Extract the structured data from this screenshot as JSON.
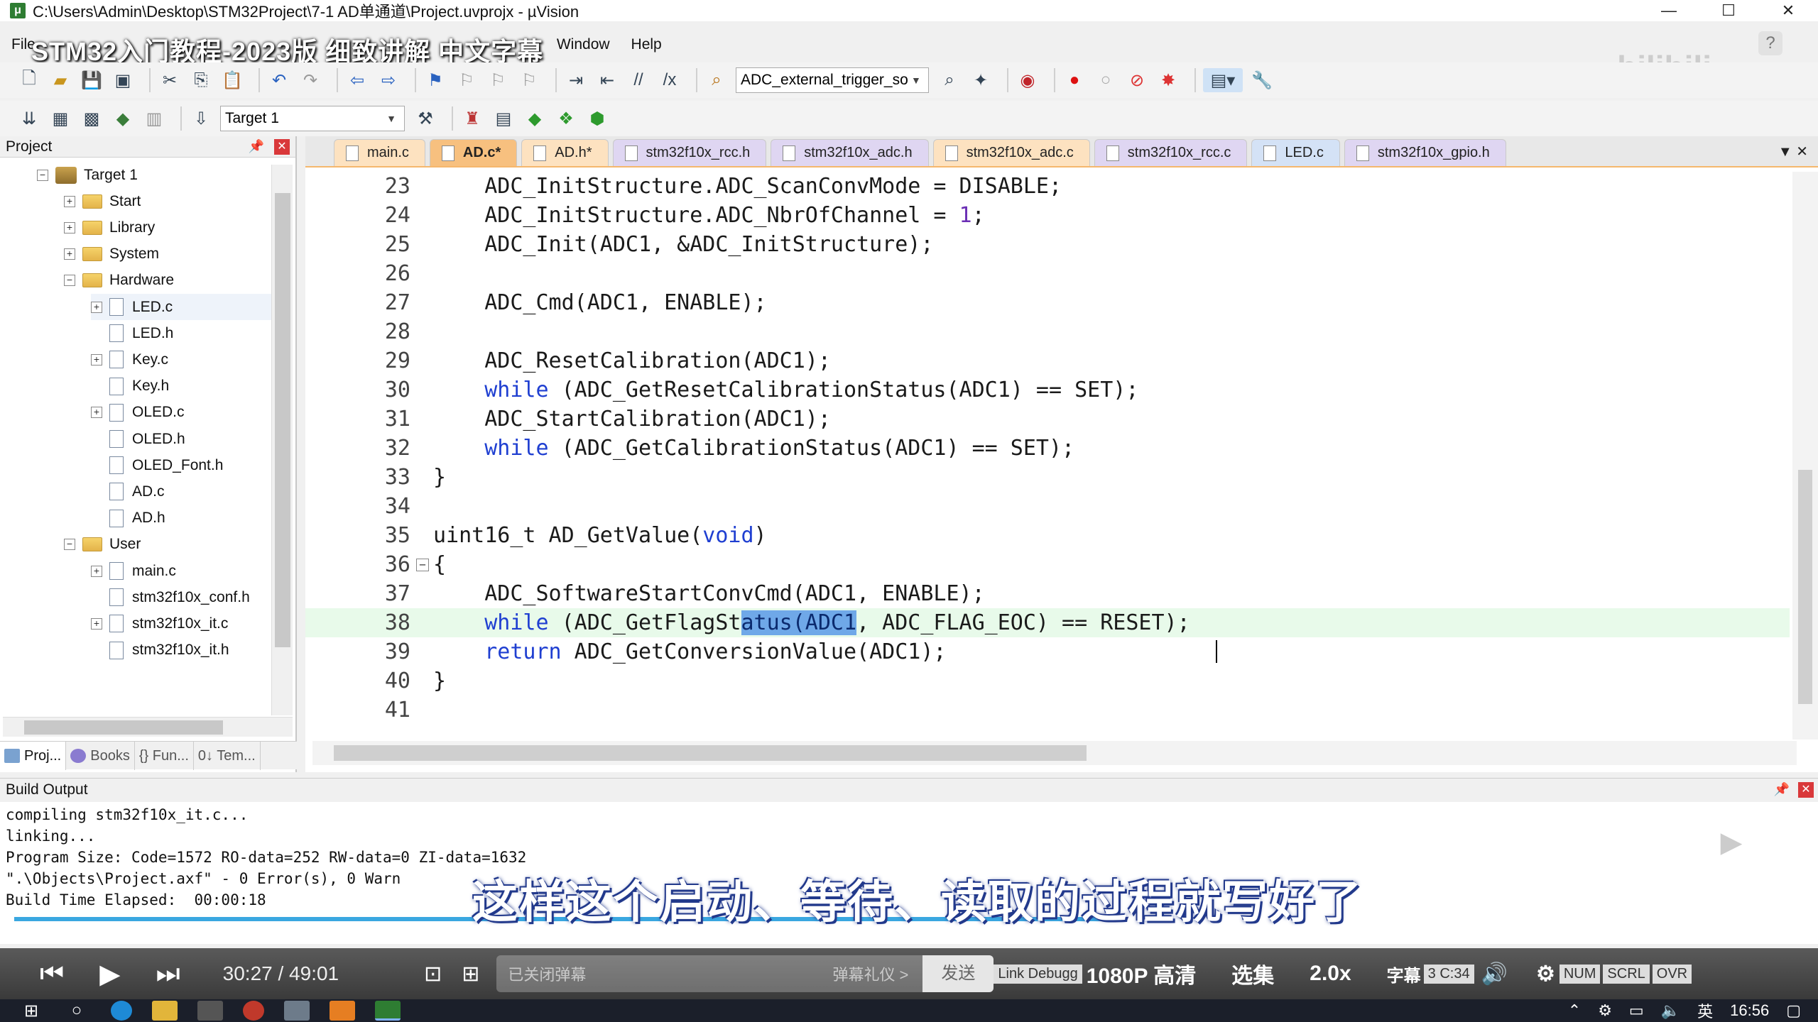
{
  "window": {
    "title": "C:\\Users\\Admin\\Desktop\\STM32Project\\7-1 AD单通道\\Project.uvprojx - µVision",
    "controls": [
      "—",
      "☐",
      "✕"
    ]
  },
  "overlay_title": "STM32入门教程-2023版 细致讲解 中文字幕",
  "watermark": "bilibili",
  "menu": {
    "items": [
      "File",
      "Window",
      "Help"
    ]
  },
  "toolbar": {
    "define_combo": "ADC_external_trigger_so",
    "target_combo": "Target 1"
  },
  "project_panel": {
    "title": "Project",
    "tree": [
      {
        "label": "Target 1",
        "level": 0,
        "type": "target",
        "exp": "−"
      },
      {
        "label": "Start",
        "level": 1,
        "type": "folder",
        "exp": "+"
      },
      {
        "label": "Library",
        "level": 1,
        "type": "folder",
        "exp": "+"
      },
      {
        "label": "System",
        "level": 1,
        "type": "folder",
        "exp": "+"
      },
      {
        "label": "Hardware",
        "level": 1,
        "type": "folder",
        "exp": "−"
      },
      {
        "label": "LED.c",
        "level": 2,
        "type": "file",
        "exp": "+"
      },
      {
        "label": "LED.h",
        "level": 2,
        "type": "file",
        "exp": ""
      },
      {
        "label": "Key.c",
        "level": 2,
        "type": "file",
        "exp": "+"
      },
      {
        "label": "Key.h",
        "level": 2,
        "type": "file",
        "exp": ""
      },
      {
        "label": "OLED.c",
        "level": 2,
        "type": "file",
        "exp": "+"
      },
      {
        "label": "OLED.h",
        "level": 2,
        "type": "file",
        "exp": ""
      },
      {
        "label": "OLED_Font.h",
        "level": 2,
        "type": "file",
        "exp": ""
      },
      {
        "label": "AD.c",
        "level": 2,
        "type": "file",
        "exp": ""
      },
      {
        "label": "AD.h",
        "level": 2,
        "type": "file",
        "exp": ""
      },
      {
        "label": "User",
        "level": 1,
        "type": "folder",
        "exp": "−"
      },
      {
        "label": "main.c",
        "level": 2,
        "type": "file",
        "exp": "+"
      },
      {
        "label": "stm32f10x_conf.h",
        "level": 2,
        "type": "file",
        "exp": ""
      },
      {
        "label": "stm32f10x_it.c",
        "level": 2,
        "type": "file",
        "exp": "+"
      },
      {
        "label": "stm32f10x_it.h",
        "level": 2,
        "type": "file",
        "exp": ""
      }
    ],
    "bottom_tabs": [
      "Proj...",
      "Books",
      "{} Fun...",
      "0↓ Tem..."
    ]
  },
  "editor": {
    "tabs": [
      {
        "label": "main.c",
        "style": "orange"
      },
      {
        "label": "AD.c*",
        "style": "active"
      },
      {
        "label": "AD.h*",
        "style": "orange"
      },
      {
        "label": "stm32f10x_rcc.h",
        "style": "violet"
      },
      {
        "label": "stm32f10x_adc.h",
        "style": "violet"
      },
      {
        "label": "stm32f10x_adc.c",
        "style": "orange"
      },
      {
        "label": "stm32f10x_rcc.c",
        "style": "violet"
      },
      {
        "label": "LED.c",
        "style": "blue"
      },
      {
        "label": "stm32f10x_gpio.h",
        "style": "violet"
      }
    ],
    "lines": [
      {
        "n": "23",
        "text": "    ADC_InitStructure.ADC_ScanConvMode = DISABLE;"
      },
      {
        "n": "24",
        "text": "    ADC_InitStructure.ADC_NbrOfChannel = 1;"
      },
      {
        "n": "25",
        "text": "    ADC_Init(ADC1, &ADC_InitStructure);"
      },
      {
        "n": "26",
        "text": ""
      },
      {
        "n": "27",
        "text": "    ADC_Cmd(ADC1, ENABLE);"
      },
      {
        "n": "28",
        "text": ""
      },
      {
        "n": "29",
        "text": "    ADC_ResetCalibration(ADC1);"
      },
      {
        "n": "30",
        "text": "    while (ADC_GetResetCalibrationStatus(ADC1) == SET);"
      },
      {
        "n": "31",
        "text": "    ADC_StartCalibration(ADC1);"
      },
      {
        "n": "32",
        "text": "    while (ADC_GetCalibrationStatus(ADC1) == SET);"
      },
      {
        "n": "33",
        "text": "}"
      },
      {
        "n": "34",
        "text": ""
      },
      {
        "n": "35",
        "text": "uint16_t AD_GetValue(void)"
      },
      {
        "n": "36",
        "text": "{"
      },
      {
        "n": "37",
        "text": "    ADC_SoftwareStartConvCmd(ADC1, ENABLE);"
      },
      {
        "n": "38",
        "text": "    while (ADC_GetFlagStatus(ADC1, ADC_FLAG_EOC) == RESET);"
      },
      {
        "n": "39",
        "text": "    return ADC_GetConversionValue(ADC1);"
      },
      {
        "n": "40",
        "text": "}"
      },
      {
        "n": "41",
        "text": ""
      }
    ]
  },
  "build_output": {
    "title": "Build Output",
    "lines": [
      "compiling stm32f10x_it.c...",
      "linking...",
      "Program Size: Code=1572 RO-data=252 RW-data=0 ZI-data=1632",
      "\".\\Objects\\Project.axf\" - 0 Error(s), 0 Warn",
      "Build Time Elapsed:  00:00:18"
    ]
  },
  "subtitle": "这样这个启动、等待、读取的过程就写好了",
  "player": {
    "time": "30:27 / 49:01",
    "danmu_placeholder": "已关闭弹幕",
    "danmu_etiquette": "弹幕礼仪 >",
    "send": "发送",
    "status_link": "Link Debugg",
    "quality": "1080P 高清",
    "episodes": "选集",
    "speed": "2.0x",
    "subtitle_btn": "字幕",
    "status_cursor": "3 C:34",
    "status_num": "NUM",
    "status_scrl": "SCRL",
    "status_ovr": "OVR"
  },
  "taskbar": {
    "ime": "英",
    "time": "16:56"
  }
}
